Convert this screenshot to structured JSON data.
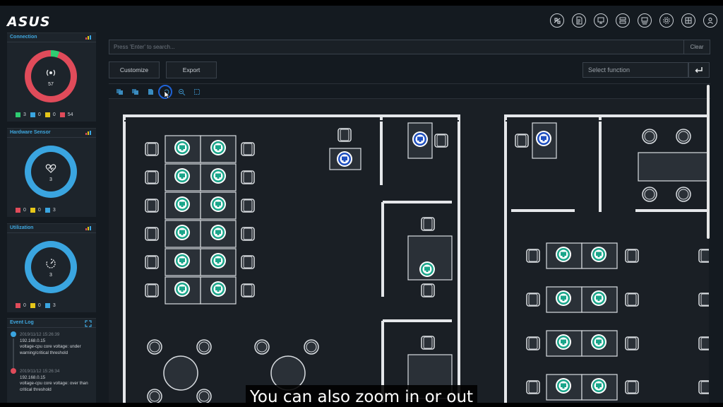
{
  "brand": {
    "logo": "ASUS"
  },
  "header_icons": [
    "network-icon",
    "document-icon",
    "device-icon",
    "server-icon",
    "monitor-icon",
    "gear-icon",
    "globe-icon",
    "user-icon"
  ],
  "sidebar": {
    "connection": {
      "title": "Connection",
      "value": "57",
      "legend": [
        {
          "color": "#2ecc71",
          "value": "3"
        },
        {
          "color": "#3aa5e0",
          "value": "0"
        },
        {
          "color": "#e6c619",
          "value": "0"
        },
        {
          "color": "#e04b5a",
          "value": "54"
        }
      ]
    },
    "hardware_sensor": {
      "title": "Hardware Sensor",
      "value": "3",
      "legend": [
        {
          "color": "#e04b5a",
          "value": "0"
        },
        {
          "color": "#e6c619",
          "value": "0"
        },
        {
          "color": "#3aa5e0",
          "value": "3"
        }
      ]
    },
    "utilization": {
      "title": "Utilization",
      "value": "3",
      "legend": [
        {
          "color": "#e04b5a",
          "value": "0"
        },
        {
          "color": "#e6c619",
          "value": "0"
        },
        {
          "color": "#3aa5e0",
          "value": "3"
        }
      ]
    },
    "event_log": {
      "title": "Event Log",
      "events": [
        {
          "time": "2019/11/12 15:26:39",
          "ip": "192.168.0.15",
          "message": "voltage-cpu core voltage: under warning/critical threshold",
          "color": "#3aa5e0"
        },
        {
          "time": "2019/11/12 15:26:34",
          "ip": "192.168.0.15",
          "message": "voltage-cpu core voltage: over than critical threshold",
          "color": "#e04b5a"
        }
      ]
    }
  },
  "search": {
    "placeholder": "Press 'Enter' to search...",
    "clear_label": "Clear"
  },
  "actions": {
    "customize_label": "Customize",
    "export_label": "Export"
  },
  "select_function": {
    "placeholder": "Select function"
  },
  "caption": "You can also zoom in or out"
}
